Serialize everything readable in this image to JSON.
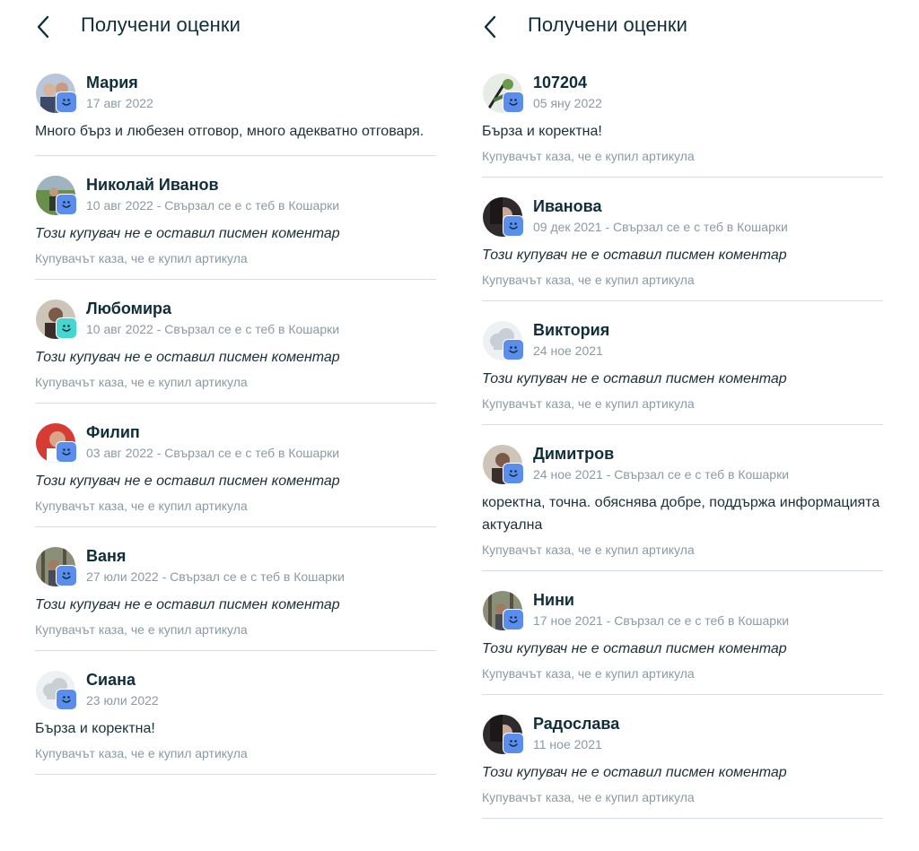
{
  "panels": [
    {
      "header": {
        "title": "Получени оценки"
      },
      "reviews": [
        {
          "name": "Мария",
          "date": "17 авг 2022",
          "comment": "Много бърз и любезен отговор, много адекватно отговаря.",
          "note": "",
          "italic": false,
          "avatar": "photo-couple",
          "badge": "blue"
        },
        {
          "name": "Николай Иванов",
          "date": "10 авг 2022 - Свързал се е с теб в Кошарки",
          "comment": "Този купувач не е оставил писмен коментар",
          "note": "Купувачът каза, че е купил артикула",
          "italic": true,
          "avatar": "photo-field",
          "badge": "blue"
        },
        {
          "name": "Любомира",
          "date": "10 авг 2022 - Свързал се е с теб в Кошарки",
          "comment": "Този купувач не е оставил писмен коментар",
          "note": "Купувачът каза, че е купил артикула",
          "italic": true,
          "avatar": "photo-person",
          "badge": "teal"
        },
        {
          "name": "Филип",
          "date": "03 авг 2022 - Свързал се е с теб в Кошарки",
          "comment": "Този купувач не е оставил писмен коментар",
          "note": "Купувачът каза, че е купил артикула",
          "italic": true,
          "avatar": "photo-red",
          "badge": "blue"
        },
        {
          "name": "Ваня",
          "date": "27 юли 2022 - Свързал се е с теб в Кошарки",
          "comment": "Този купувач не е оставил писмен коментар",
          "note": "Купувачът каза, че е купил артикула",
          "italic": true,
          "avatar": "photo-forest",
          "badge": "blue"
        },
        {
          "name": "Сиана",
          "date": "23 юли 2022",
          "comment": "Бърза и коректна!",
          "note": "Купувачът каза, че е купил артикула",
          "italic": false,
          "avatar": "default-cloud",
          "badge": "blue"
        }
      ]
    },
    {
      "header": {
        "title": "Получени оценки"
      },
      "reviews": [
        {
          "name": "107204",
          "date": "05 яну 2022",
          "comment": "Бърза и коректна!",
          "note": "Купувачът каза, че е купил артикула",
          "italic": false,
          "avatar": "photo-plant",
          "badge": "blue"
        },
        {
          "name": "Иванова",
          "date": "09 дек 2021 - Свързал се е с теб в Кошарки",
          "comment": "Този купувач не е оставил писмен коментар",
          "note": "Купувачът каза, че е купил артикула",
          "italic": true,
          "avatar": "photo-dark",
          "badge": "blue"
        },
        {
          "name": "Виктория",
          "date": "24 ное 2021",
          "comment": "Този купувач не е оставил писмен коментар",
          "note": "Купувачът каза, че е купил артикула",
          "italic": true,
          "avatar": "default-cloud",
          "badge": "blue"
        },
        {
          "name": "Димитров",
          "date": "24 ное 2021 - Свързал се е с теб в Кошарки",
          "comment": "коректна, точна. обяснява добре, поддържа информацията актуална",
          "note": "Купувачът каза, че е купил артикула",
          "italic": false,
          "avatar": "photo-person",
          "badge": "blue"
        },
        {
          "name": "Нини",
          "date": "17 ное 2021 - Свързал се е с теб в Кошарки",
          "comment": "Този купувач не е оставил писмен коментар",
          "note": "Купувачът каза, че е купил артикула",
          "italic": true,
          "avatar": "photo-forest",
          "badge": "blue"
        },
        {
          "name": "Радослава",
          "date": "11 ное 2021",
          "comment": "Този купувач не е оставил писмен коментар",
          "note": "Купувачът каза, че е купил артикула",
          "italic": true,
          "avatar": "photo-dark",
          "badge": "blue"
        }
      ]
    }
  ],
  "colors": {
    "text": "#0f2e3a",
    "muted": "#8a9aa3",
    "badge_blue": "#5b8dee",
    "badge_teal": "#45d6cf",
    "divider": "#d6dcdf"
  }
}
